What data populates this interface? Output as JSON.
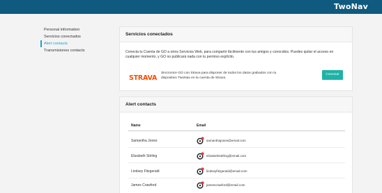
{
  "header": {
    "brand": "TwoNav",
    "color": "#0f5a7e"
  },
  "sidebar": {
    "items": [
      {
        "label": "Personal information",
        "active": false
      },
      {
        "label": "Servicios conectados",
        "active": false
      },
      {
        "label": "Alert contacts",
        "active": true
      },
      {
        "label": "Transmisiones contacts",
        "active": false
      }
    ]
  },
  "services": {
    "title": "Servicios conectados",
    "description": "Conecta tu Cuenta de GO a otros Servicios Web, para compartir fácilmente con tus amigos y conocidos. Puedes quitar el acceso en cualquier momento, y GO no publicará nada con tu permiso explícito.",
    "strava": {
      "logo": "STRAVA",
      "logo_color": "#fc4c02",
      "description": "Sincronice GO con Strava para disponer de todos los datos grabados con tu dispositivo TwoNav en la cuenta de Strava.",
      "button_label": "Conectar",
      "button_color": "#1db3a6"
    }
  },
  "alerts": {
    "title": "Alert contacts",
    "columns": {
      "name": "Name",
      "email": "Email"
    },
    "rows": [
      {
        "name": "Samantha Jones",
        "email": "samanthajones@email.com",
        "icon": "alert-contact-icon"
      },
      {
        "name": "Elizabeth Stirling",
        "email": "elizabethstirling@email.com",
        "icon": "alert-contact-icon"
      },
      {
        "name": "Lindsey Fitzgerald",
        "email": "lindseyfitzgerald@email.com",
        "icon": "alert-contact-icon"
      },
      {
        "name": "James Crawford",
        "email": "jamescrawford@email.com",
        "icon": "alert-contact-icon"
      }
    ]
  }
}
